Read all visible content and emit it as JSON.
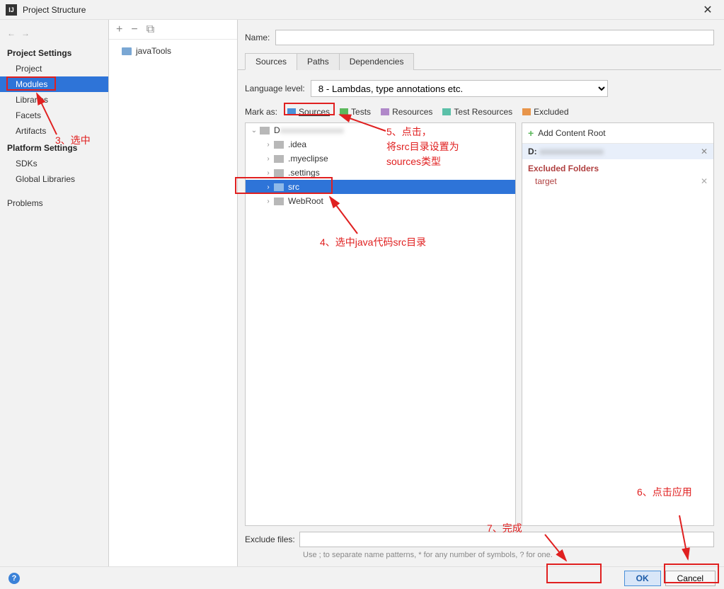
{
  "window": {
    "title": "Project Structure"
  },
  "sidebar": {
    "section1": "Project Settings",
    "items1": [
      "Project",
      "Modules",
      "Libraries",
      "Facets",
      "Artifacts"
    ],
    "section2": "Platform Settings",
    "items2": [
      "SDKs",
      "Global Libraries"
    ],
    "problems": "Problems"
  },
  "modules": {
    "item0": "javaTools"
  },
  "content": {
    "name_label": "Name:",
    "tabs": [
      "Sources",
      "Paths",
      "Dependencies"
    ],
    "lang_label": "Language level:",
    "lang_value": "8 - Lambdas, type annotations etc.",
    "mark_label": "Mark as:",
    "mark_buttons": {
      "sources": "Sources",
      "tests": "Tests",
      "resources": "Resources",
      "test_resources": "Test Resources",
      "excluded": "Excluded"
    },
    "tree": {
      "root": "D",
      "items": [
        ".idea",
        ".myeclipse",
        ".settings",
        "src",
        "WebRoot"
      ]
    },
    "right": {
      "add_root": "Add Content Root",
      "d_label": "D:",
      "excluded_head": "Excluded Folders",
      "excluded_item": "target"
    },
    "exclude_label": "Exclude files:",
    "exclude_hint": "Use ; to separate name patterns, * for any number of symbols, ? for one."
  },
  "footer": {
    "ok": "OK",
    "cancel": "Cancel"
  },
  "annotations": {
    "a3": "3、选中",
    "a4": "4、选中java代码src目录",
    "a5": "5、点击，\n将src目录设置为\nsources类型",
    "a6": "6、点击应用",
    "a7": "7、完成"
  }
}
